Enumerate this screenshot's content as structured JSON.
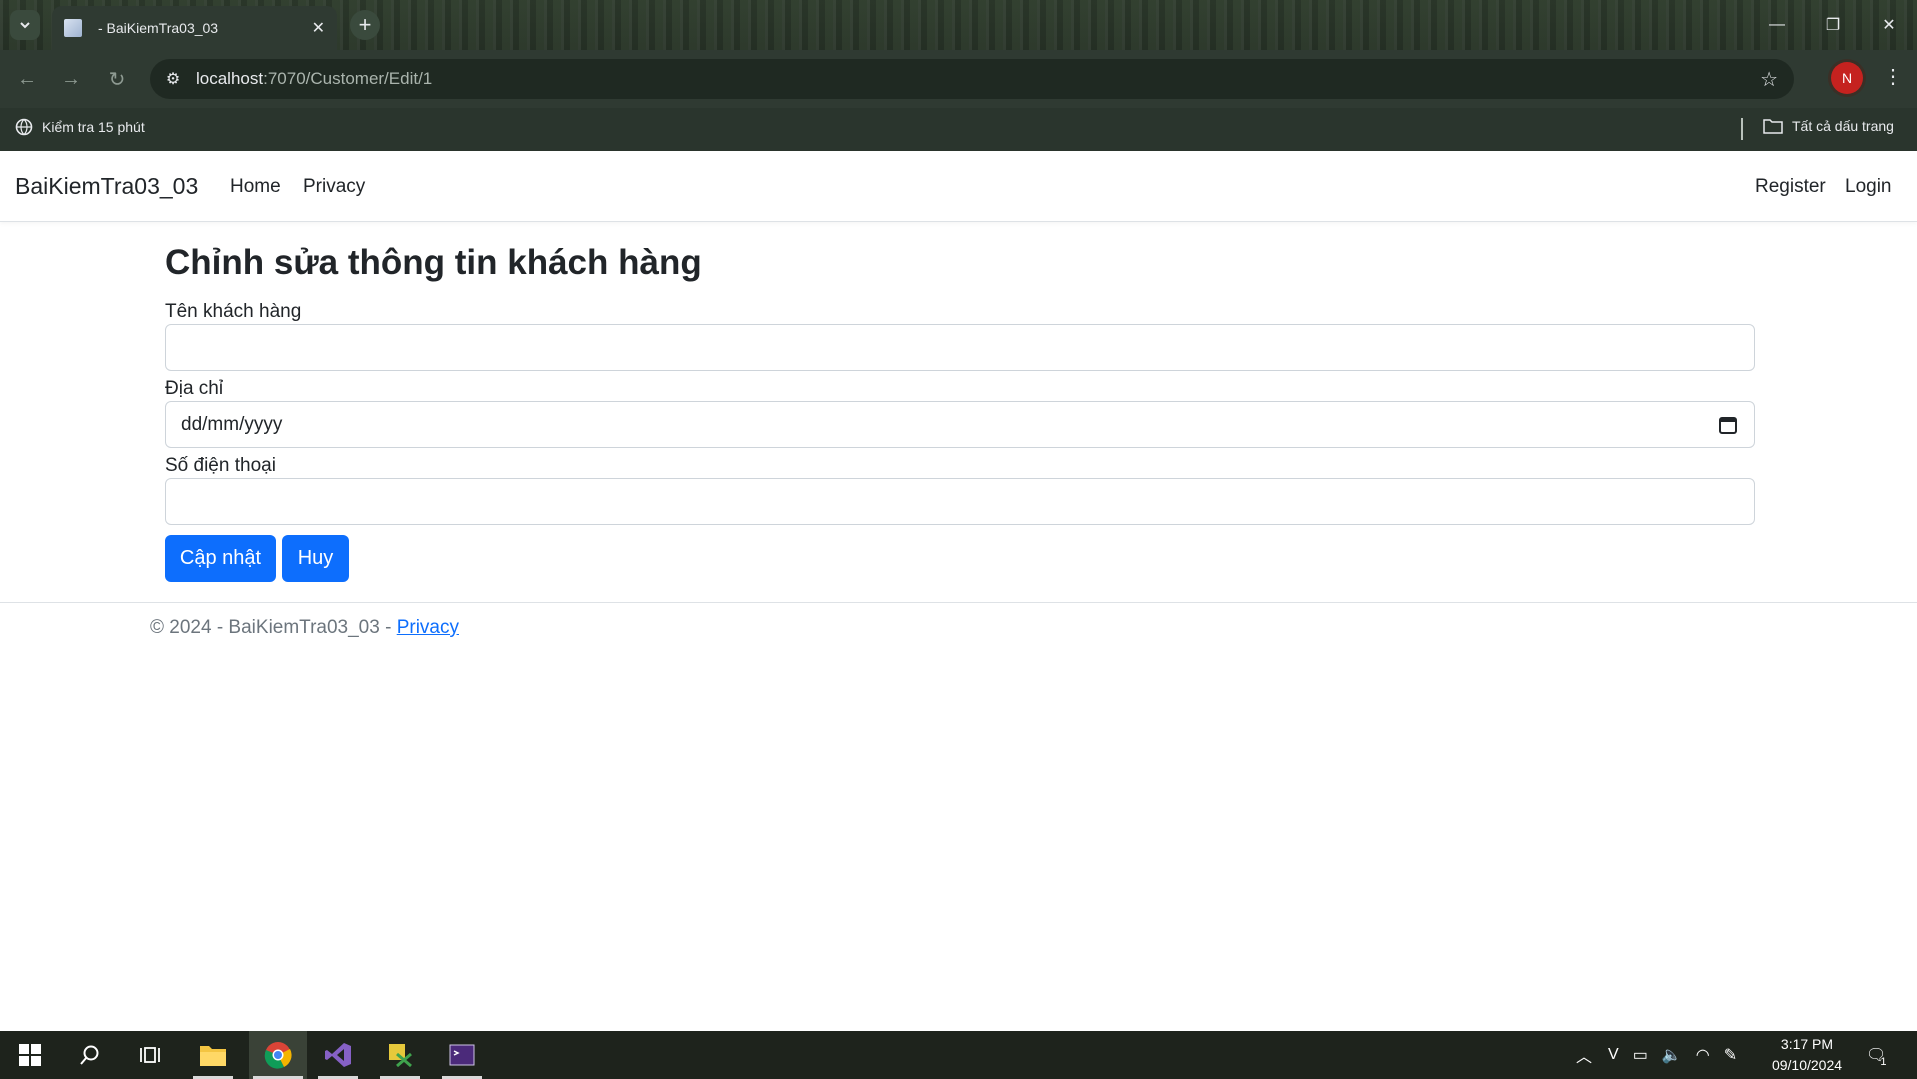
{
  "browser": {
    "tab_title": "- BaiKiemTra03_03",
    "url_host": "localhost",
    "url_path": ":7070/Customer/Edit/1",
    "profile_initial": "N",
    "bookmarks": {
      "left_item": "Kiểm tra 15 phút",
      "right_item": "Tất cả dấu trang"
    }
  },
  "navbar": {
    "brand": "BaiKiemTra03_03",
    "links": [
      "Home",
      "Privacy"
    ],
    "right_links": [
      "Register",
      "Login"
    ]
  },
  "form": {
    "title": "Chỉnh sửa thông tin khách hàng",
    "fields": [
      {
        "label": "Tên khách hàng",
        "value": ""
      },
      {
        "label": "Địa chỉ",
        "value": "dd/mm/yyyy"
      },
      {
        "label": "Số điện thoại",
        "value": ""
      }
    ],
    "submit_label": "Cập nhật",
    "cancel_label": "Huy"
  },
  "footer": {
    "text": "© 2024 - BaiKiemTra03_03 - ",
    "link": "Privacy"
  },
  "taskbar": {
    "time": "3:17 PM",
    "date": "09/10/2024",
    "notification_count": "1"
  },
  "colors": {
    "primary": "#0d6efd",
    "chrome_bg": "#2f3a32",
    "taskbar_bg": "#1e231c"
  }
}
